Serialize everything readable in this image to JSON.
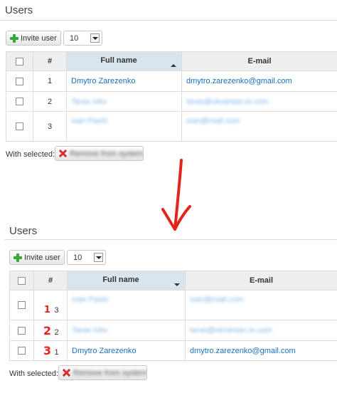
{
  "title": "Users",
  "toolbar": {
    "invite_label": "Invite user",
    "page_size": "10"
  },
  "table": {
    "headers": {
      "num": "#",
      "name": "Full name",
      "email": "E-mail"
    }
  },
  "before": {
    "rows": [
      {
        "num": "1",
        "name": "Dmytro Zarezenko",
        "email": "dmytro.zarezenko@gmail.com"
      },
      {
        "num": "2",
        "name": "Taras Ivko",
        "email": "taras@ukrainian.io.com"
      },
      {
        "num": "3",
        "name": "Ivan Pavlo",
        "email": "ivan@mail.com"
      }
    ]
  },
  "after": {
    "rows": [
      {
        "mark": "1",
        "num": "3",
        "name": "Ivan Pavlo",
        "email": "ivan@mail.com"
      },
      {
        "mark": "2",
        "num": "2",
        "name": "Taras Ivko",
        "email": "taras@ukrainian.io.com"
      },
      {
        "mark": "3",
        "num": "1",
        "name": "Dmytro Zarezenko",
        "email": "dmytro.zarezenko@gmail.com"
      }
    ]
  },
  "bulk": {
    "label": "With selected:",
    "remove_label": "Remove from system"
  },
  "colors": {
    "accent": "#1a6fbd",
    "annotation": "#e3241b"
  }
}
